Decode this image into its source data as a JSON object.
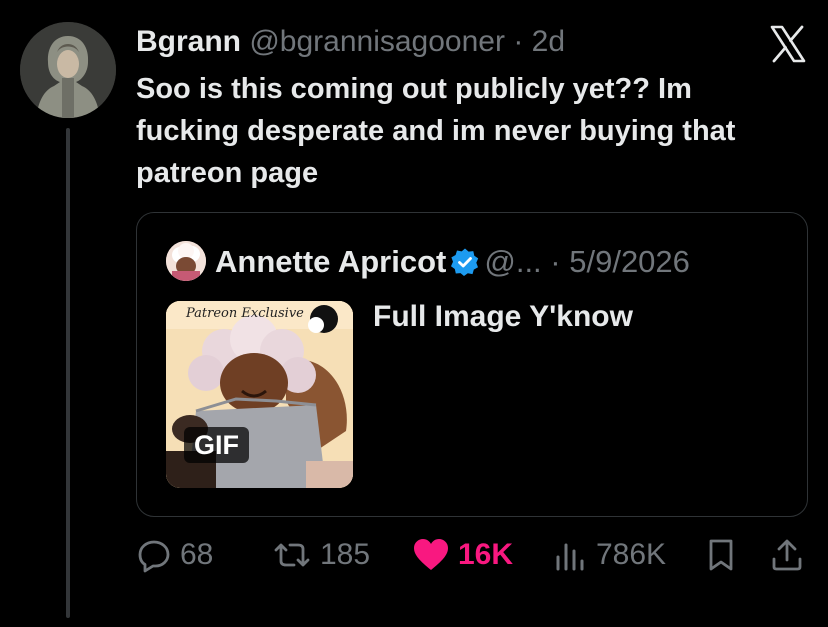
{
  "tweet": {
    "display_name": "Bgrann",
    "handle": "@bgrannisagooner",
    "separator": " · ",
    "time": "2d",
    "text": "Soo is this coming out publicly yet?? Im fucking desperate and im never buying that patreon page"
  },
  "quote": {
    "display_name": "Annette Apricot",
    "handle": "@...",
    "separator": " · ",
    "date": "5/9/2026",
    "text": "Full Image Y'know",
    "media_caption": "Patreon Exclusive",
    "media_badge": "GIF"
  },
  "actions": {
    "replies": "68",
    "reposts": "185",
    "likes": "16K",
    "views": "786K"
  },
  "colors": {
    "background": "#000000",
    "text": "#e7e9ea",
    "muted": "#71767b",
    "like": "#f91880",
    "verified": "#1d9bf0"
  },
  "icons": [
    "x-logo-icon",
    "verified-badge-icon",
    "reply-icon",
    "repost-icon",
    "heart-icon",
    "views-icon",
    "bookmark-icon",
    "share-icon"
  ]
}
